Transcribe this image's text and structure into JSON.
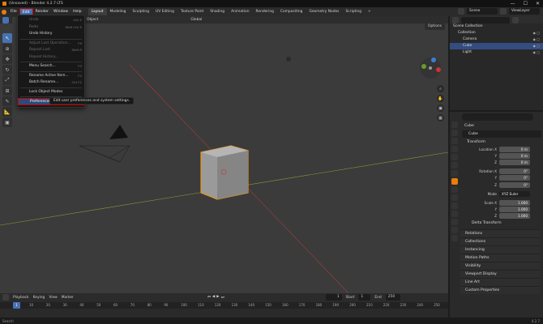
{
  "window": {
    "title": "(Unsaved) - Blender 4.2.7 LTS",
    "controls": [
      "—",
      "☐",
      "✕"
    ]
  },
  "menubar": {
    "items": [
      "File",
      "Edit",
      "Render",
      "Window",
      "Help"
    ],
    "workspaces": [
      "Layout",
      "Modeling",
      "Sculpting",
      "UV Editing",
      "Texture Paint",
      "Shading",
      "Animation",
      "Rendering",
      "Compositing",
      "Geometry Nodes",
      "Scripting"
    ],
    "scene": "Scene",
    "view_layer": "ViewLayer"
  },
  "viewport_header": {
    "items": [
      "Object",
      "Global"
    ],
    "options": "Options"
  },
  "edit_menu": {
    "items": [
      {
        "label": "Undo",
        "shortcut": "Ctrl Z",
        "disabled": true
      },
      {
        "label": "Redo",
        "shortcut": "Shift Ctrl Z",
        "disabled": true
      },
      {
        "label": "Undo History",
        "shortcut": "",
        "disabled": false
      },
      {
        "label": "Adjust Last Operation...",
        "shortcut": "F9",
        "disabled": true
      },
      {
        "label": "Repeat Last",
        "shortcut": "Shift R",
        "disabled": true
      },
      {
        "label": "Repeat History...",
        "shortcut": "",
        "disabled": true
      },
      {
        "label": "Menu Search...",
        "shortcut": "F3",
        "disabled": false
      },
      {
        "label": "Rename Active Item...",
        "shortcut": "F2",
        "disabled": false
      },
      {
        "label": "Batch Rename...",
        "shortcut": "Ctrl F2",
        "disabled": false
      },
      {
        "label": "Lock Object Modes",
        "shortcut": "",
        "disabled": false
      },
      {
        "label": "Preferences...",
        "shortcut": "Ctrl ,",
        "disabled": false
      }
    ]
  },
  "tooltip": "Edit user preferences and system settings.",
  "outliner": {
    "rows": [
      {
        "label": "Scene Collection",
        "depth": 0
      },
      {
        "label": "Collection",
        "depth": 1
      },
      {
        "label": "Camera",
        "depth": 2
      },
      {
        "label": "Cube",
        "depth": 2
      },
      {
        "label": "Light",
        "depth": 2
      }
    ],
    "selected": "Cube"
  },
  "properties": {
    "object": "Cube",
    "object_name": "Cube",
    "transform_title": "Transform",
    "location": {
      "label": "Location X",
      "x": "0 m",
      "y": "0 m",
      "z": "0 m"
    },
    "rotation": {
      "label": "Rotation X",
      "x": "0°",
      "y": "0°",
      "z": "0°"
    },
    "mode": {
      "label": "Mode",
      "value": "XYZ Euler"
    },
    "scale": {
      "label": "Scale X",
      "x": "1.000",
      "y": "1.000",
      "z": "1.000"
    },
    "axis_y": "Y",
    "axis_z": "Z",
    "delta": "Delta Transform",
    "panels": [
      "Relations",
      "Collections",
      "Instancing",
      "Motion Paths",
      "Visibility",
      "Viewport Display",
      "Line Art",
      "Custom Properties"
    ]
  },
  "timeline": {
    "header": [
      "Playback",
      "Keying",
      "View",
      "Marker"
    ],
    "current_frame": "1",
    "start": "1",
    "end": "250",
    "start_label": "Start",
    "end_label": "End",
    "ticks": [
      "1",
      "10",
      "20",
      "30",
      "40",
      "50",
      "60",
      "70",
      "80",
      "90",
      "100",
      "110",
      "120",
      "130",
      "140",
      "150",
      "160",
      "170",
      "180",
      "190",
      "200",
      "210",
      "220",
      "230",
      "240",
      "250"
    ]
  },
  "statusbar": {
    "left": "Search",
    "version": "4.2.7"
  }
}
